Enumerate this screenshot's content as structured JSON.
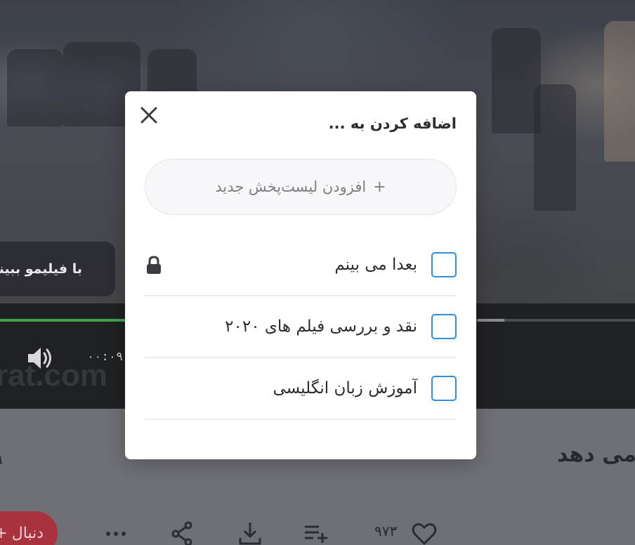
{
  "background": {
    "overlay_text": "با فیلیمو ببینید",
    "current_time": "۰۰:۰۹",
    "watermark": "rat.com",
    "video_title": "می دهد",
    "left_number": "۹",
    "add_button_label": "دنبال",
    "add_button_plus": "+",
    "like_count": "۹۷۳",
    "progress_fraction": 0.2
  },
  "modal": {
    "title": "اضافه کردن به ...",
    "new_playlist_label": "افزودن لیست‌پخش جدید",
    "new_playlist_plus": "+",
    "playlists": [
      {
        "label": "بعدا می بینم",
        "checked": false,
        "locked": true
      },
      {
        "label": "نقد و بررسی فیلم های ۲۰۲۰",
        "checked": false,
        "locked": false
      },
      {
        "label": "آموزش زبان انگلیسی",
        "checked": false,
        "locked": false
      }
    ]
  },
  "colors": {
    "accent": "#2d8fdc",
    "danger": "#a8323e",
    "progress": "#3fa34d"
  }
}
